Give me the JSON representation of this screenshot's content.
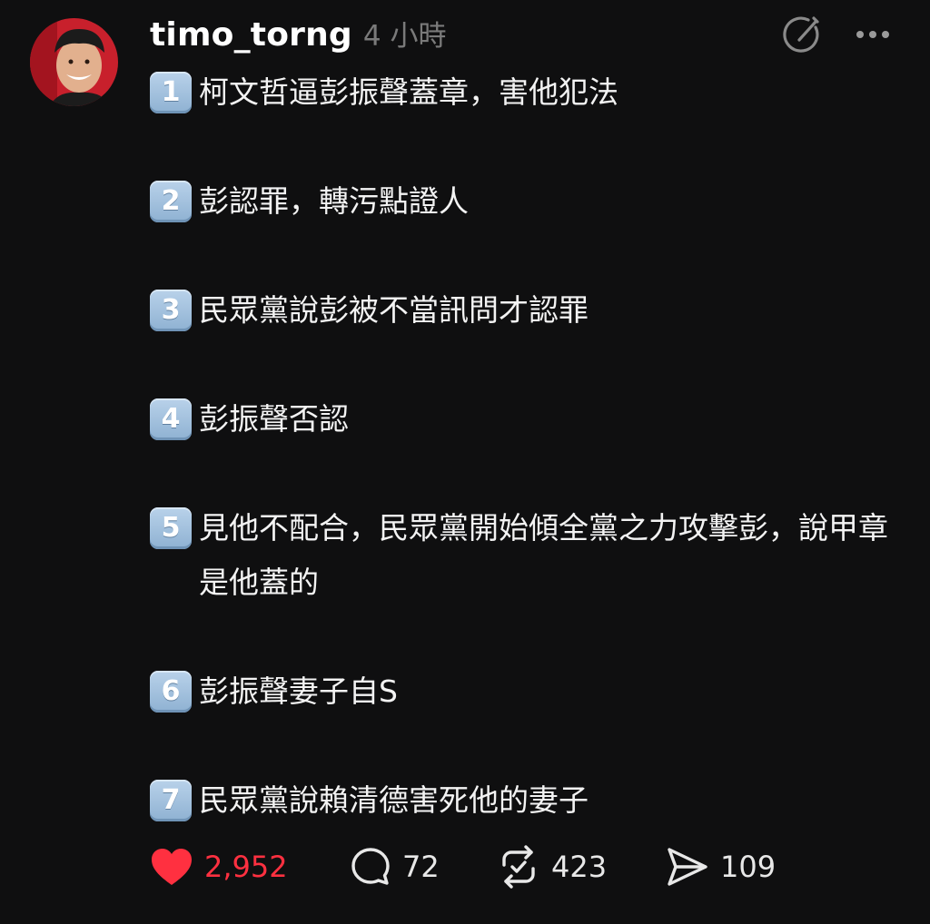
{
  "post": {
    "username": "timo_torng",
    "time": "4 小時",
    "items": [
      {
        "number": "1",
        "text": "柯文哲逼彭振聲蓋章，害他犯法"
      },
      {
        "number": "2",
        "text": "彭認罪，轉污點證人"
      },
      {
        "number": "3",
        "text": "民眾黨說彭被不當訊問才認罪"
      },
      {
        "number": "4",
        "text": "彭振聲否認"
      },
      {
        "number": "5",
        "text": "見他不配合，民眾黨開始傾全黨之力攻擊彭，說甲章是他蓋的"
      },
      {
        "number": "6",
        "text": "彭振聲妻子自S"
      },
      {
        "number": "7",
        "text": "民眾黨說賴清德害死他的妻子"
      }
    ],
    "stats": {
      "likes": "2,952",
      "comments": "72",
      "reposts": "423",
      "shares": "109"
    }
  },
  "icons": {
    "avatar": "avatar",
    "edit": "edit-circle-icon",
    "more": "more-dots-icon",
    "like": "heart-icon",
    "comment": "comment-bubble-icon",
    "repost": "repost-icon",
    "share": "share-send-icon"
  },
  "colors": {
    "background": "#0f0f10",
    "text": "#f3f3f3",
    "muted": "#7a7a7a",
    "like": "#ff3040",
    "keycap": "#a8c6e3"
  }
}
